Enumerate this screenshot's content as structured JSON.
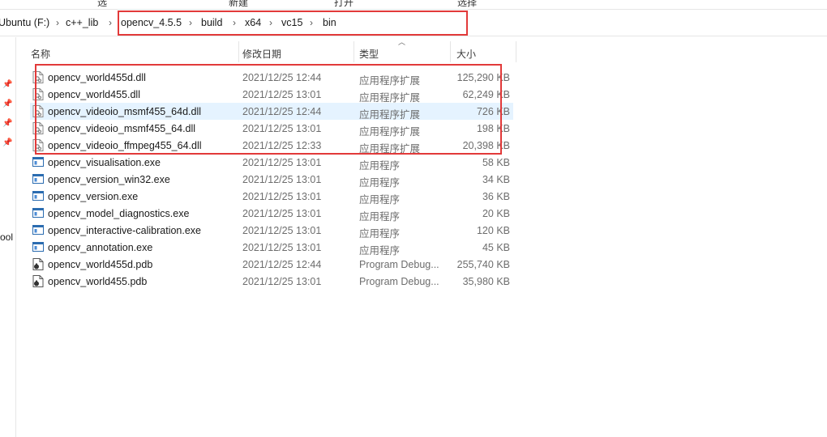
{
  "ribbon": {
    "items": [
      "选",
      "新建",
      "打开",
      "选择"
    ]
  },
  "breadcrumb": {
    "items": [
      "Ubuntu (F:)",
      "c++_lib",
      "opencv_4.5.5",
      "build",
      "x64",
      "vc15",
      "bin"
    ],
    "separator": "›"
  },
  "nav": {
    "partial_label": "ool"
  },
  "columns": {
    "name": "名称",
    "date": "修改日期",
    "type": "类型",
    "size": "大小"
  },
  "files": [
    {
      "name": "opencv_world455d.dll",
      "date": "2021/12/25 12:44",
      "type": "应用程序扩展",
      "size": "125,290 KB",
      "icon": "dll-file-icon"
    },
    {
      "name": "opencv_world455.dll",
      "date": "2021/12/25 13:01",
      "type": "应用程序扩展",
      "size": "62,249 KB",
      "icon": "dll-file-icon"
    },
    {
      "name": "opencv_videoio_msmf455_64d.dll",
      "date": "2021/12/25 12:44",
      "type": "应用程序扩展",
      "size": "726 KB",
      "icon": "dll-file-icon"
    },
    {
      "name": "opencv_videoio_msmf455_64.dll",
      "date": "2021/12/25 13:01",
      "type": "应用程序扩展",
      "size": "198 KB",
      "icon": "dll-file-icon"
    },
    {
      "name": "opencv_videoio_ffmpeg455_64.dll",
      "date": "2021/12/25 12:33",
      "type": "应用程序扩展",
      "size": "20,398 KB",
      "icon": "dll-file-icon"
    },
    {
      "name": "opencv_visualisation.exe",
      "date": "2021/12/25 13:01",
      "type": "应用程序",
      "size": "58 KB",
      "icon": "exe-file-icon"
    },
    {
      "name": "opencv_version_win32.exe",
      "date": "2021/12/25 13:01",
      "type": "应用程序",
      "size": "34 KB",
      "icon": "exe-file-icon"
    },
    {
      "name": "opencv_version.exe",
      "date": "2021/12/25 13:01",
      "type": "应用程序",
      "size": "36 KB",
      "icon": "exe-file-icon"
    },
    {
      "name": "opencv_model_diagnostics.exe",
      "date": "2021/12/25 13:01",
      "type": "应用程序",
      "size": "20 KB",
      "icon": "exe-file-icon"
    },
    {
      "name": "opencv_interactive-calibration.exe",
      "date": "2021/12/25 13:01",
      "type": "应用程序",
      "size": "120 KB",
      "icon": "exe-file-icon"
    },
    {
      "name": "opencv_annotation.exe",
      "date": "2021/12/25 13:01",
      "type": "应用程序",
      "size": "45 KB",
      "icon": "exe-file-icon"
    },
    {
      "name": "opencv_world455d.pdb",
      "date": "2021/12/25 12:44",
      "type": "Program Debug...",
      "size": "255,740 KB",
      "icon": "pdb-file-icon"
    },
    {
      "name": "opencv_world455.pdb",
      "date": "2021/12/25 13:01",
      "type": "Program Debug...",
      "size": "35,980 KB",
      "icon": "pdb-file-icon"
    }
  ],
  "highlight_color": "#e23a3a",
  "hover_row_color": "#e5f3ff"
}
